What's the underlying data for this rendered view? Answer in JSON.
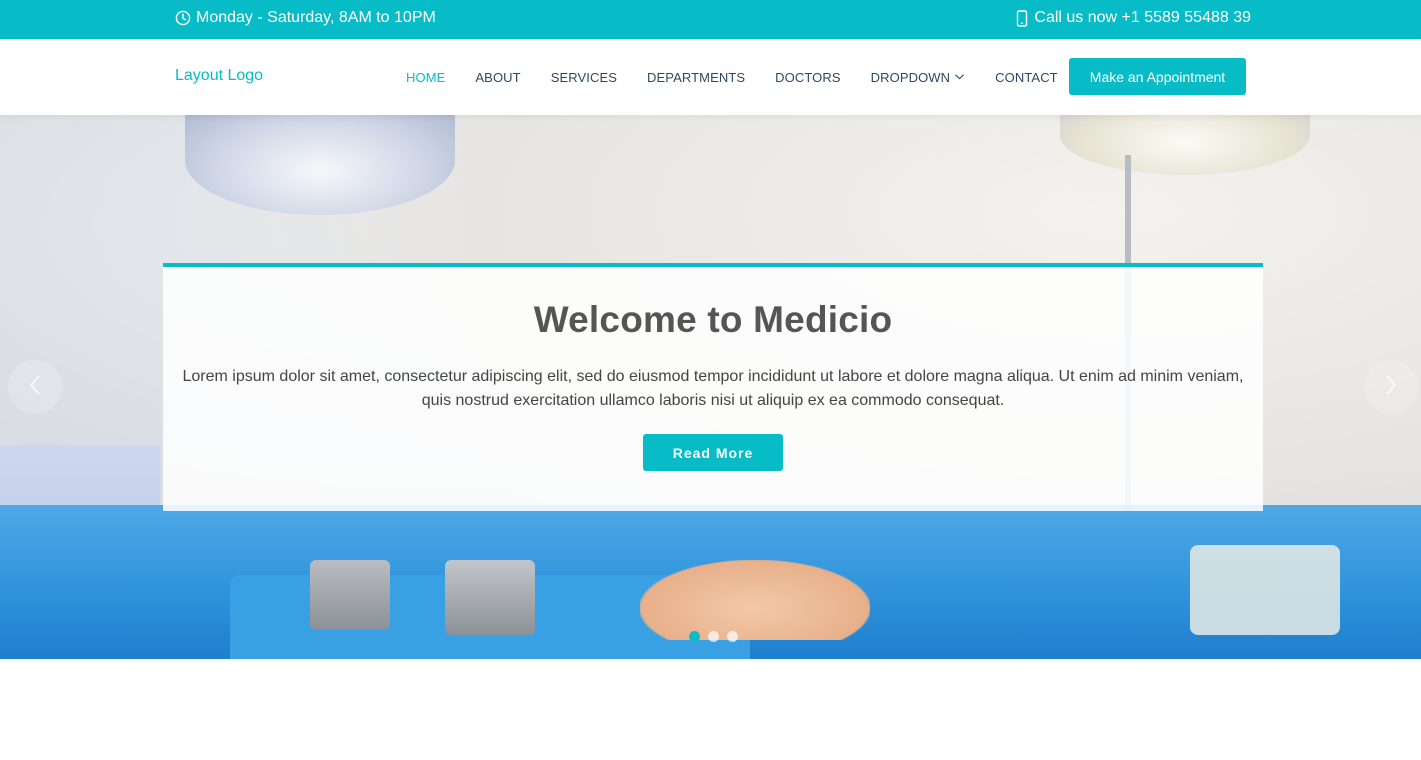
{
  "topbar": {
    "hours": "Monday - Saturday, 8AM to 10PM",
    "hours_icon": "clock-icon",
    "phone": "Call us now +1 5589 55488 39",
    "phone_icon": "phone-icon",
    "background": "#07bcc6"
  },
  "header": {
    "logo": "Layout Logo",
    "nav": [
      {
        "label": "HOME",
        "active": true
      },
      {
        "label": "ABOUT"
      },
      {
        "label": "SERVICES"
      },
      {
        "label": "DEPARTMENTS"
      },
      {
        "label": "DOCTORS"
      },
      {
        "label": "DROPDOWN",
        "icon": "chevron-down-icon"
      },
      {
        "label": "CONTACT"
      }
    ],
    "appointment_button": "Make an Appointment"
  },
  "hero": {
    "title": "Welcome to Medicio",
    "description": "Lorem ipsum dolor sit amet, consectetur adipiscing elit, sed do eiusmod tempor incididunt ut labore et dolore magna aliqua. Ut enim ad minim veniam, quis nostrud exercitation ullamco laboris nisi ut aliquip ex ea commodo consequat.",
    "button": "Read More",
    "prev_icon": "chevron-left-icon",
    "next_icon": "chevron-right-icon",
    "slides_count": 3,
    "active_slide": 1
  },
  "colors": {
    "accent": "#07bcc6",
    "nav_text": "#2c4964",
    "heading": "#555555"
  }
}
